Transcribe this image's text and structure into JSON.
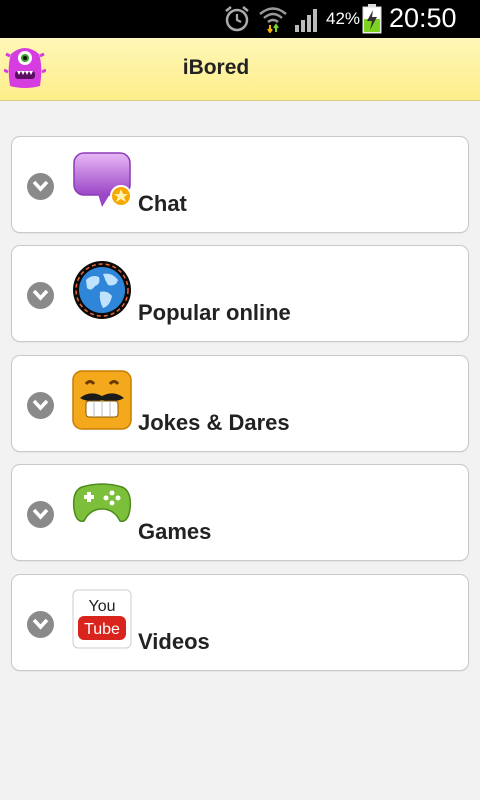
{
  "status_bar": {
    "battery_percent": "42%",
    "time": "20:50"
  },
  "header": {
    "title": "iBored",
    "logo_icon": "purple-monster-icon"
  },
  "menu": {
    "items": [
      {
        "label": "Chat",
        "icon": "chat-bubble-icon"
      },
      {
        "label": "Popular online",
        "icon": "globe-icon"
      },
      {
        "label": "Jokes & Dares",
        "icon": "mustache-smiley-icon"
      },
      {
        "label": "Games",
        "icon": "gamepad-icon"
      },
      {
        "label": "Videos",
        "icon": "youtube-icon"
      }
    ]
  },
  "youtube_logo": {
    "you": "You",
    "tube": "Tube"
  },
  "colors": {
    "header_bg": "#fdee8a",
    "chevron": "#8a8a8a",
    "status_bar": "#000000",
    "battery_fill": "#7ed321"
  }
}
